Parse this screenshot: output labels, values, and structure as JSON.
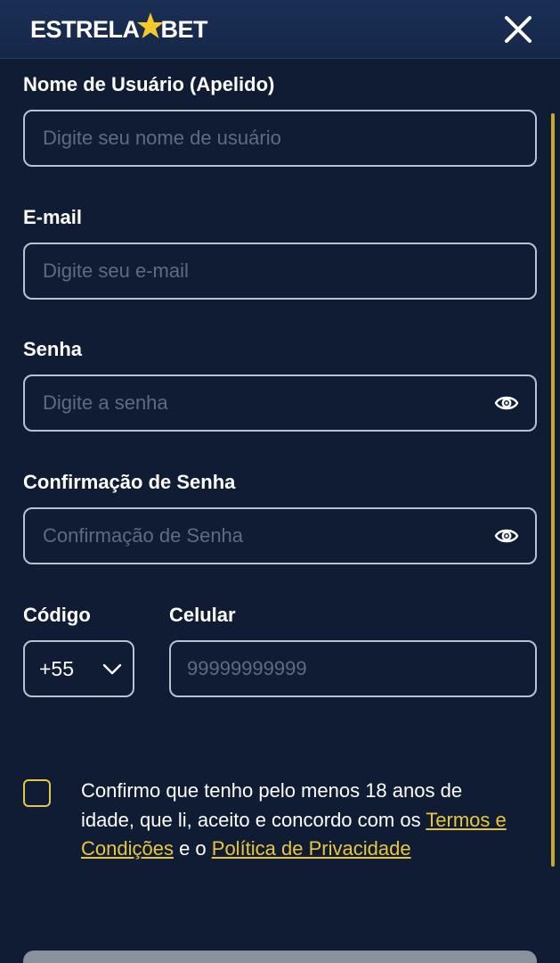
{
  "header": {
    "logo_left": "ESTRELA",
    "logo_right": "BET",
    "accent_color": "#f6c82b"
  },
  "form": {
    "username": {
      "label": "Nome de Usuário (Apelido)",
      "placeholder": "Digite seu nome de usuário",
      "value": ""
    },
    "email": {
      "label": "E-mail",
      "placeholder": "Digite seu e-mail",
      "value": ""
    },
    "password": {
      "label": "Senha",
      "placeholder": "Digite a senha",
      "value": ""
    },
    "password_confirm": {
      "label": "Confirmação de Senha",
      "placeholder": "Confirmação de Senha",
      "value": ""
    },
    "code": {
      "label": "Código",
      "selected": "+55"
    },
    "phone": {
      "label": "Celular",
      "placeholder": "99999999999",
      "value": ""
    },
    "terms": {
      "text_before": "Confirmo que tenho pelo menos 18 anos de idade, que li, aceito e concordo com os ",
      "link_terms": "Termos e Condições",
      "text_middle": " e o ",
      "link_privacy": "Política de Privacidade",
      "checked": false
    }
  },
  "icons": {
    "close": "close-icon",
    "eye": "eye-icon",
    "chevron": "chevron-down-icon",
    "star": "star-icon"
  }
}
